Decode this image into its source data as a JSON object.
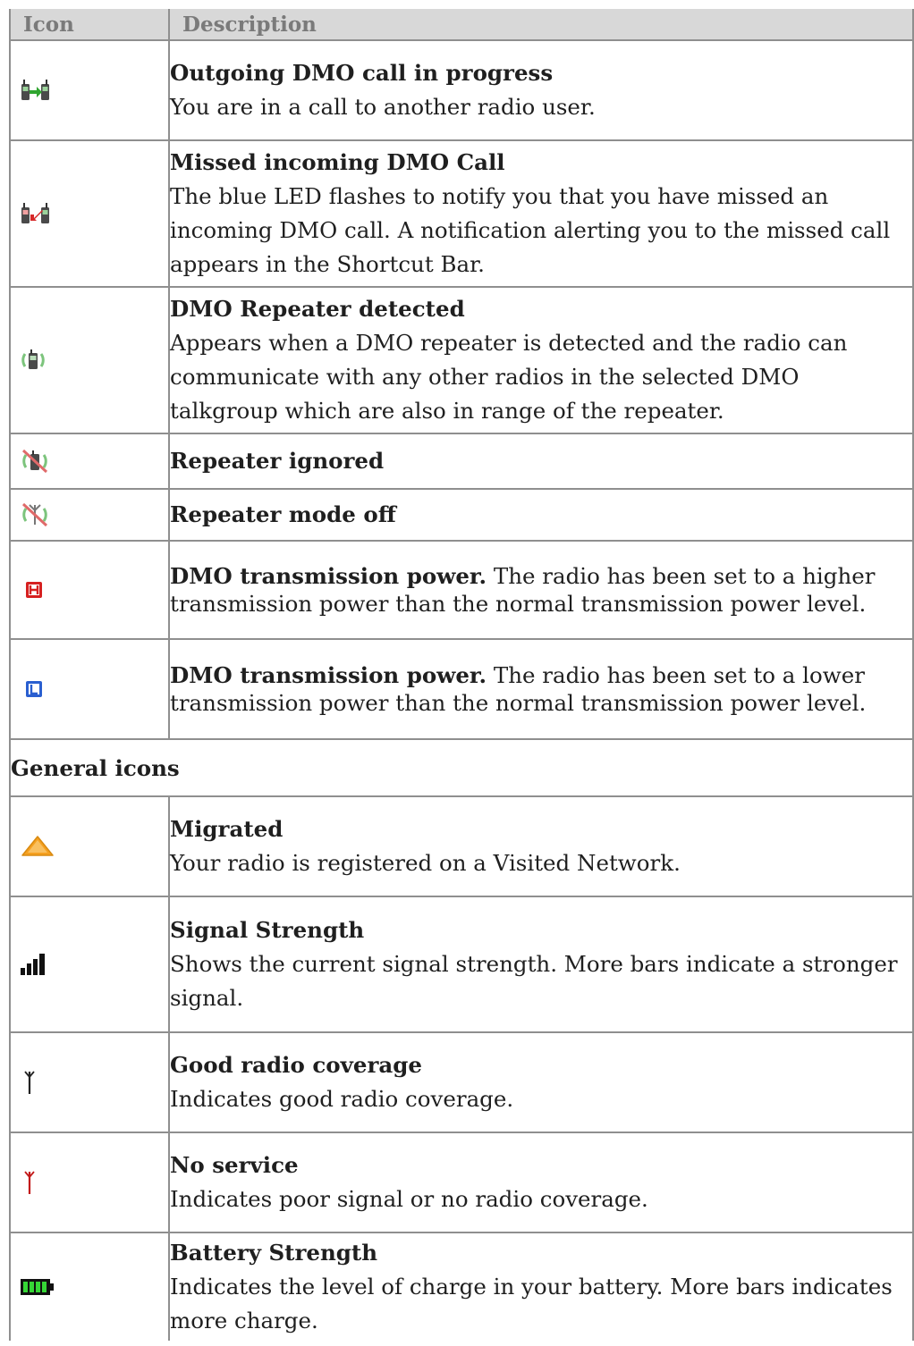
{
  "header": {
    "icon_col": "Icon",
    "desc_col": "Description"
  },
  "dmo_rows": [
    {
      "icon": "outgoing-dmo-call-icon",
      "title": "Outgoing DMO call in progress",
      "text": "You are in a call to another radio user."
    },
    {
      "icon": "missed-dmo-call-icon",
      "title": "Missed incoming DMO Call",
      "text": "The blue LED flashes to notify you that you have missed an incoming DMO call. A notification alerting you to the missed call appears in the Shortcut Bar."
    },
    {
      "icon": "dmo-repeater-detected-icon",
      "title": "DMO Repeater detected",
      "text": "Appears when a DMO repeater is detected and the radio can communicate with any other radios in the selected DMO talkgroup which are also in range of the repeater."
    },
    {
      "icon": "repeater-ignored-icon",
      "title": "Repeater ignored",
      "text": ""
    },
    {
      "icon": "repeater-mode-off-icon",
      "title": "Repeater mode off",
      "text": ""
    },
    {
      "icon": "high-power-icon",
      "title": "DMO transmission power.",
      "text": "The radio has been set to a higher transmission power than the normal transmission power level."
    },
    {
      "icon": "low-power-icon",
      "title": "DMO transmission power.",
      "text": "The radio has been set to a lower transmission power than the normal transmission power level."
    }
  ],
  "section_title": "General icons",
  "general_rows": [
    {
      "icon": "migrated-icon",
      "title": "Migrated",
      "text": "Your radio is registered on a Visited Network."
    },
    {
      "icon": "signal-strength-icon",
      "title": "Signal Strength",
      "text": "Shows the current signal strength. More bars indicate a stronger signal."
    },
    {
      "icon": "good-coverage-antenna-icon",
      "title": "Good radio coverage",
      "text": "Indicates good radio coverage."
    },
    {
      "icon": "no-service-antenna-icon",
      "title": "No service",
      "text": "Indicates poor signal or no radio coverage."
    },
    {
      "icon": "battery-strength-icon",
      "title": "Battery Strength",
      "text": "Indicates the level of charge in your battery. More bars indicates more charge."
    }
  ],
  "colors": {
    "header_bg": "#d8d8d8",
    "border": "#8f8f8f",
    "high_power": "#d62020",
    "low_power": "#2a5fd0",
    "migrated": "#f5a020",
    "battery": "#2ecc2e",
    "no_service": "#c21818"
  }
}
